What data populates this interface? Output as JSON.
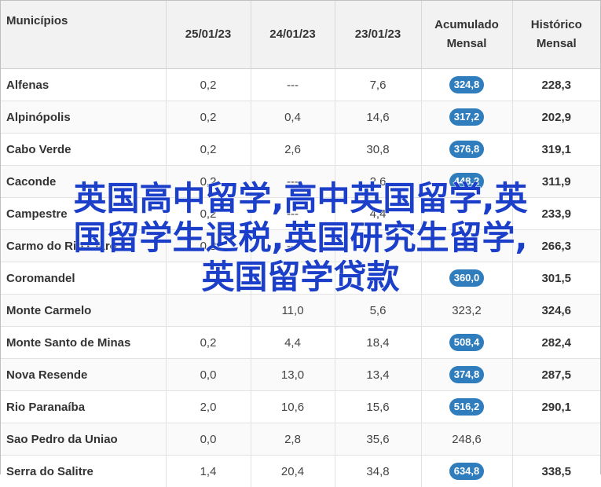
{
  "table": {
    "headers": [
      "Municípios",
      "25/01/23",
      "24/01/23",
      "23/01/23",
      "Acumulado Mensal",
      "Histórico Mensal"
    ],
    "rows": [
      {
        "name": "Alfenas",
        "d1": "0,2",
        "d2": "---",
        "d3": "7,6",
        "acc": "324,8",
        "acc_badge": true,
        "hist": "228,3"
      },
      {
        "name": "Alpinópolis",
        "d1": "0,2",
        "d2": "0,4",
        "d3": "14,6",
        "acc": "317,2",
        "acc_badge": true,
        "hist": "202,9"
      },
      {
        "name": "Cabo Verde",
        "d1": "0,2",
        "d2": "2,6",
        "d3": "30,8",
        "acc": "376,8",
        "acc_badge": true,
        "hist": "319,1"
      },
      {
        "name": "Caconde",
        "d1": "0,2",
        "d2": "---",
        "d3": "2,6",
        "acc": "448,2",
        "acc_badge": true,
        "hist": "311,9"
      },
      {
        "name": "Campestre",
        "d1": "0,2",
        "d2": "---",
        "d3": "4,4",
        "acc": "",
        "acc_badge": true,
        "hist": "233,9"
      },
      {
        "name": "Carmo do Rio Claro",
        "d1": "0,2",
        "d2": "---",
        "d3": "",
        "acc": "",
        "acc_badge": true,
        "hist": "266,3"
      },
      {
        "name": "Coromandel",
        "d1": "",
        "d2": "",
        "d3": "",
        "acc": "360,0",
        "acc_badge": true,
        "hist": "301,5"
      },
      {
        "name": "Monte Carmelo",
        "d1": "",
        "d2": "11,0",
        "d3": "5,6",
        "acc": "323,2",
        "acc_badge": false,
        "hist": "324,6"
      },
      {
        "name": "Monte Santo de Minas",
        "d1": "0,2",
        "d2": "4,4",
        "d3": "18,4",
        "acc": "508,4",
        "acc_badge": true,
        "hist": "282,4"
      },
      {
        "name": "Nova Resende",
        "d1": "0,0",
        "d2": "13,0",
        "d3": "13,4",
        "acc": "374,8",
        "acc_badge": true,
        "hist": "287,5"
      },
      {
        "name": "Rio Paranaíba",
        "d1": "2,0",
        "d2": "10,6",
        "d3": "15,6",
        "acc": "516,2",
        "acc_badge": true,
        "hist": "290,1"
      },
      {
        "name": "Sao Pedro da Uniao",
        "d1": "0,0",
        "d2": "2,8",
        "d3": "35,6",
        "acc": "248,6",
        "acc_badge": false,
        "hist": ""
      },
      {
        "name": "Serra do Salitre",
        "d1": "1,4",
        "d2": "20,4",
        "d3": "34,8",
        "acc": "634,8",
        "acc_badge": true,
        "hist": "338,5"
      }
    ]
  },
  "overlay": {
    "line1": "英国高中留学,高中英国留学,英",
    "line2": "国留学生退税,英国研究生留学,",
    "line3": "英国留学贷款"
  },
  "colors": {
    "badge": "#2f7dbd",
    "overlay_text": "#1b3fc9",
    "header_bg": "#f2f2f2"
  }
}
